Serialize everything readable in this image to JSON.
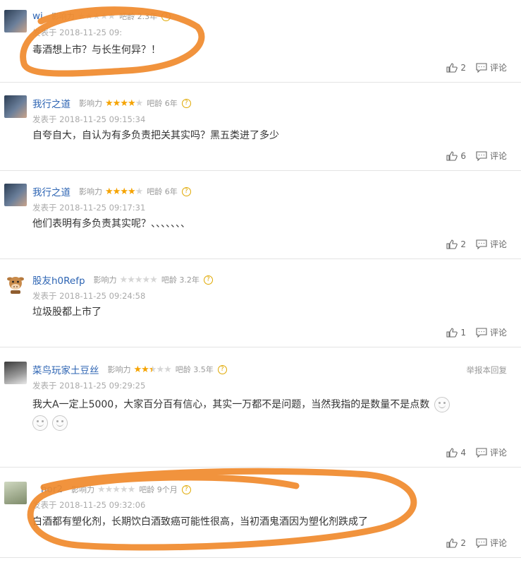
{
  "labels": {
    "influence": "影响力",
    "bar_age_prefix": "吧龄",
    "posted_prefix": "发表于",
    "reply": "评论",
    "report_reply": "举报本回复"
  },
  "comments": [
    {
      "username": "wi",
      "stars": 0,
      "bar_age": "2.3年",
      "time": "2018-11-25 09:",
      "text": "毒酒想上市？与长生何异？！",
      "likes": "2"
    },
    {
      "username": "我行之道",
      "stars": 4,
      "bar_age": "6年",
      "time": "2018-11-25 09:15:34",
      "text": "自夸自大，自认为有多负责把关其实吗？黑五类进了多少",
      "likes": "6"
    },
    {
      "username": "我行之道",
      "stars": 4,
      "bar_age": "6年",
      "time": "2018-11-25 09:17:31",
      "text": "他们表明有多负责其实呢？、、、、、、、",
      "likes": "2"
    },
    {
      "username": "股友h0Refp",
      "stars": 0,
      "bar_age": "3.2年",
      "time": "2018-11-25 09:24:58",
      "text": "垃圾股都上市了",
      "likes": "1"
    },
    {
      "username": "菜鸟玩家土豆丝",
      "stars": 2.5,
      "bar_age": "3.5年",
      "time": "2018-11-25 09:29:25",
      "text": "我大A一定上5000，大家百分百有信心，其实一万都不是问题，当然我指的是数量不是点数",
      "likes": "4"
    },
    {
      "username": "hor2",
      "stars": 0,
      "bar_age": "9个月",
      "time": "2018-11-25 09:32:06",
      "text": "白酒都有塑化剂，长期饮白酒致癌可能性很高，当初酒鬼酒因为塑化剂跌成了",
      "likes": "2"
    }
  ],
  "colors": {
    "username": "#2d64b3",
    "star_on": "#f5a300",
    "annotation": "#f08a2c"
  }
}
